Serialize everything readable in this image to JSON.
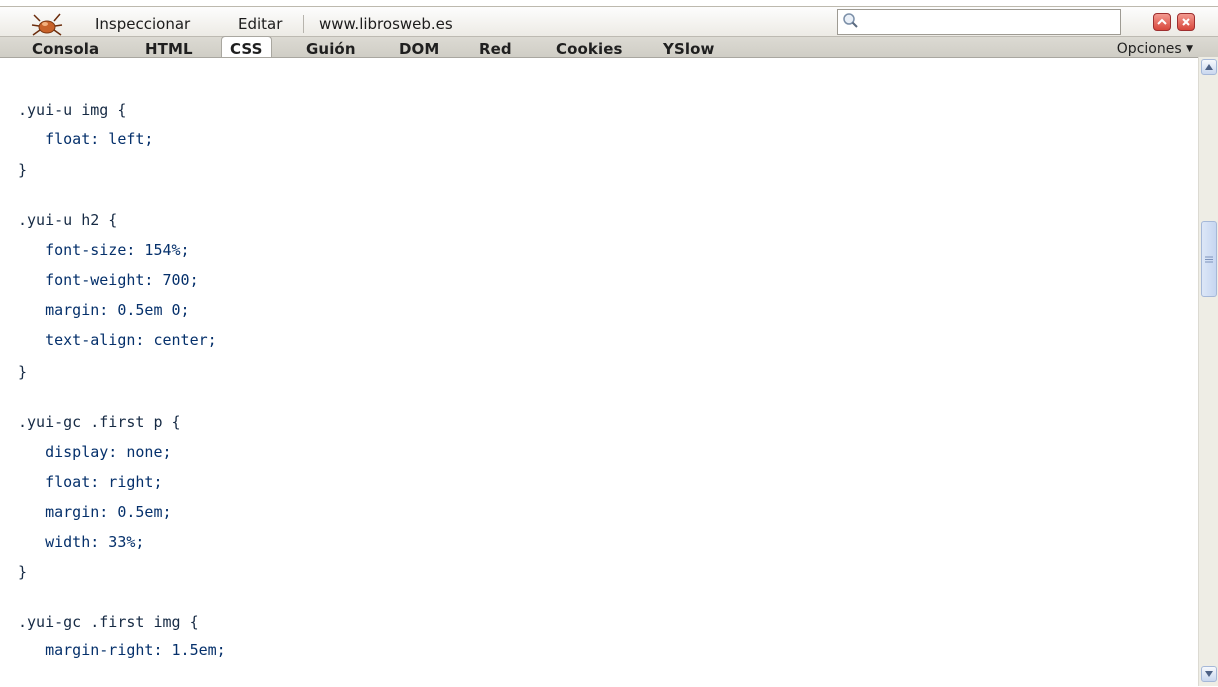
{
  "toolbar": {
    "menu": [
      "Inspeccionar",
      "Editar"
    ],
    "url": "www.librosweb.es",
    "search": {
      "value": "",
      "placeholder": ""
    }
  },
  "tabs": [
    "Consola",
    "HTML",
    "CSS",
    "Guión",
    "DOM",
    "Red",
    "Cookies",
    "YSlow"
  ],
  "active_tab": "CSS",
  "options_label": "Opciones",
  "code_lines": [
    ".yui-u img {",
    "   float: left;",
    "}",
    "",
    ".yui-u h2 {",
    "   font-size: 154%;",
    "   font-weight: 700;",
    "   margin: 0.5em 0;",
    "   text-align: center;",
    "}",
    "",
    ".yui-gc .first p {",
    "   display: none;",
    "   float: right;",
    "   margin: 0.5em;",
    "   width: 33%;",
    "}",
    "",
    ".yui-gc .first img {",
    "   margin-right: 1.5em;"
  ],
  "icons": {
    "logo": "firebug-bug-icon",
    "search": "magnifier-icon",
    "minimize": "minimize-icon",
    "close": "close-icon",
    "options_arrow": "dropdown-arrow-icon",
    "scroll_up": "scroll-up-arrow-icon",
    "scroll_down": "scroll-down-arrow-icon",
    "scroll_grip": "scroll-grip-icon"
  },
  "colors": {
    "window_button": "#d8473c",
    "code_text": "#05306b",
    "scrollbar_accent": "#c6d6f1"
  }
}
